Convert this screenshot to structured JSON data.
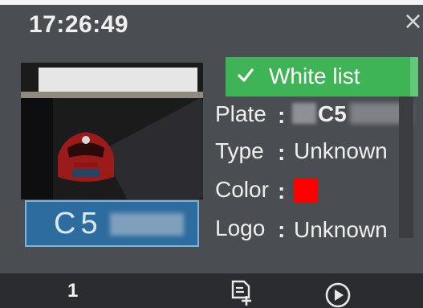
{
  "header": {
    "time": "17:26:49",
    "close_glyph": "×"
  },
  "snapshot": {
    "plate_text": "C5",
    "plate_masked_icon": "blurred-characters"
  },
  "list_badge": {
    "label": "White list",
    "icon": "check-icon",
    "color": "#3eb456"
  },
  "fields": {
    "plate": {
      "label": "Plate",
      "value": "C5"
    },
    "type": {
      "label": "Type",
      "value": "Unknown"
    },
    "color": {
      "label": "Color",
      "swatch": "#ff0000"
    },
    "logo": {
      "label": "Logo",
      "value": "Unknown"
    }
  },
  "footer": {
    "page_number": "1",
    "doc_icon": "add-document-icon",
    "play_icon": "play-icon"
  }
}
